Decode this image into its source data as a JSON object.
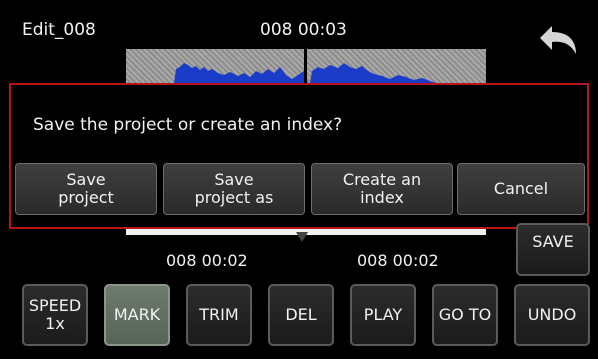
{
  "header": {
    "project_name": "Edit_008",
    "timecode": "008 00:03",
    "undo_icon": "undo-arrow-icon"
  },
  "dialog": {
    "message": "Save the project or create an index?",
    "buttons": {
      "save_project": "Save\nproject",
      "save_project_as": "Save\nproject as",
      "create_index": "Create an\nindex",
      "cancel": "Cancel"
    },
    "border_color": "#b3151b"
  },
  "timeline": {
    "mark_in_time": "008 00:02",
    "mark_out_time": "008 00:02"
  },
  "save_label": "SAVE",
  "toolbar": {
    "speed": "SPEED\n1x",
    "mark": "MARK",
    "trim": "TRIM",
    "del": "DEL",
    "play": "PLAY",
    "goto": "GO TO",
    "undo": "UNDO"
  },
  "colors": {
    "waveform": "#1a3cc8",
    "active_button": "#6e7a6e"
  }
}
